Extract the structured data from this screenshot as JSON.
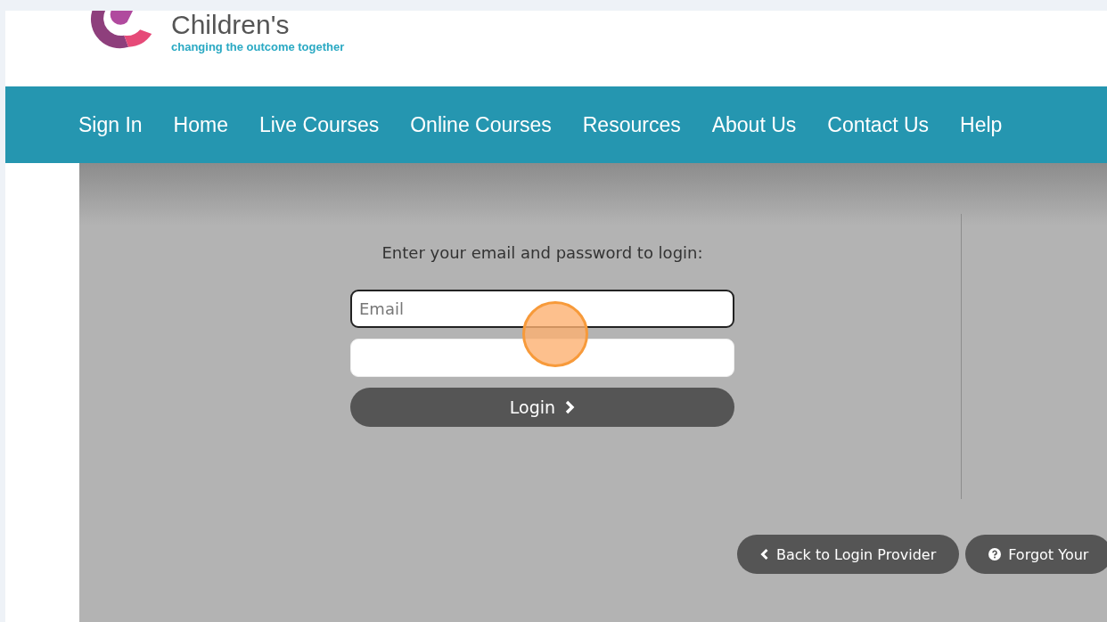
{
  "logo": {
    "name": "Children's",
    "tagline": "changing the outcome together"
  },
  "nav": [
    {
      "label": "Sign In"
    },
    {
      "label": "Home"
    },
    {
      "label": "Live Courses"
    },
    {
      "label": "Online Courses"
    },
    {
      "label": "Resources"
    },
    {
      "label": "About Us"
    },
    {
      "label": "Contact Us"
    },
    {
      "label": "Help"
    }
  ],
  "login": {
    "prompt": "Enter your email and password to login:",
    "email": {
      "placeholder": "Email"
    },
    "button": "Login"
  },
  "actions": [
    {
      "kind": "back",
      "label": "Back to Login Provider"
    },
    {
      "kind": "help",
      "label": "Forgot Your"
    }
  ]
}
